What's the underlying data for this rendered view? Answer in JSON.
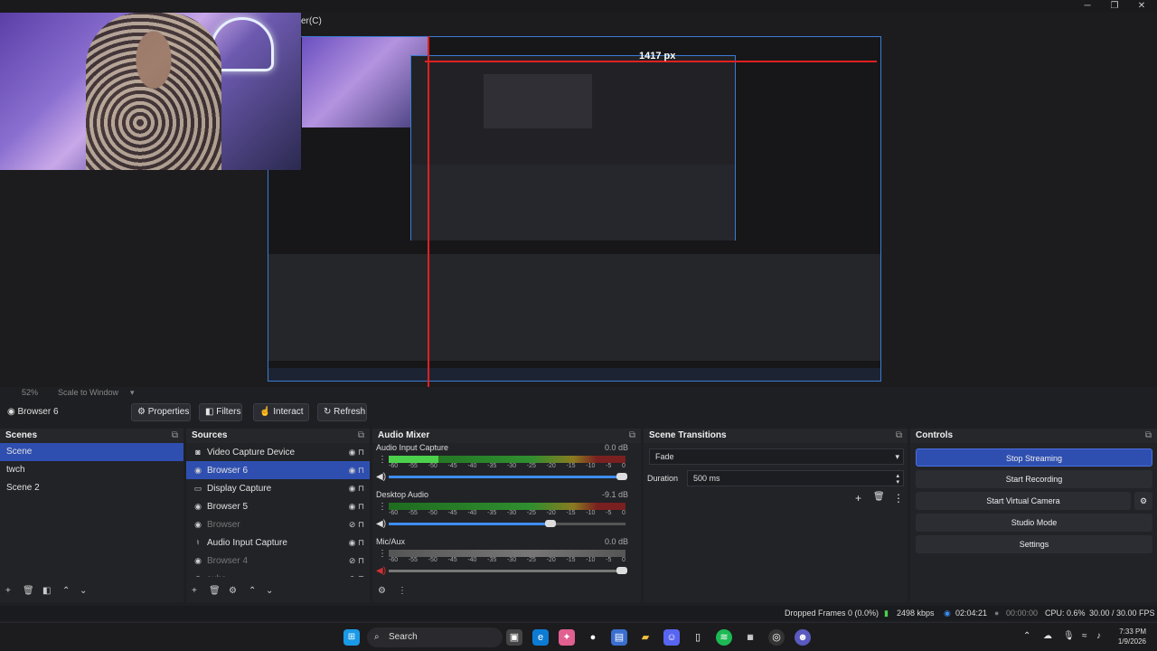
{
  "window": {
    "title_fragment": "er(C)",
    "controls": [
      "─",
      "❐",
      "✕"
    ]
  },
  "preview": {
    "measure_label": "1417 px",
    "zoom_label": "52%",
    "zoom_mode": "Scale to Window"
  },
  "toolbar": {
    "source_name": "Browser 6",
    "properties": "Properties",
    "filters": "Filters",
    "interact": "Interact",
    "refresh": "Refresh"
  },
  "scenes": {
    "title": "Scenes",
    "items": [
      {
        "label": "Scene",
        "selected": true
      },
      {
        "label": "twch"
      },
      {
        "label": "Scene 2"
      }
    ]
  },
  "sources": {
    "title": "Sources",
    "items": [
      {
        "label": "Video Capture Device",
        "icon": "camera-icon"
      },
      {
        "label": "Browser 6",
        "icon": "globe-icon"
      },
      {
        "label": "Display Capture",
        "icon": "monitor-icon"
      },
      {
        "label": "Browser 5",
        "icon": "globe-icon"
      },
      {
        "label": "Browser",
        "icon": "globe-icon"
      },
      {
        "label": "Audio Input Capture",
        "icon": "microphone-icon"
      },
      {
        "label": "Browser 4",
        "icon": "globe-icon"
      },
      {
        "label": "subs",
        "icon": "globe-icon"
      }
    ]
  },
  "mixer": {
    "title": "Audio Mixer",
    "ticks": [
      "-60",
      "-55",
      "-50",
      "-45",
      "-40",
      "-35",
      "-30",
      "-25",
      "-20",
      "-15",
      "-10",
      "-5",
      "0"
    ],
    "channels": [
      {
        "name": "Audio Input Capture",
        "db": "0.0 dB",
        "level": 0.21,
        "volume": 1.0
      },
      {
        "name": "Desktop Audio",
        "db": "-9.1 dB",
        "level": 0,
        "volume": 0.7
      },
      {
        "name": "Mic/Aux",
        "db": "0.0 dB",
        "level": 0,
        "volume": 1.0
      }
    ]
  },
  "transitions": {
    "title": "Scene Transitions",
    "selected": "Fade",
    "duration_label": "Duration",
    "duration_value": "500 ms"
  },
  "controls": {
    "title": "Controls",
    "stop_streaming": "Stop Streaming",
    "start_recording": "Start Recording",
    "start_virtual_camera": "Start Virtual Camera",
    "studio_mode": "Studio Mode",
    "settings": "Settings"
  },
  "status": {
    "dropped": "Dropped Frames 0 (0.0%)",
    "bitrate": "2498 kbps",
    "stream_time": "02:04:21",
    "rec_time": "00:00:00",
    "cpu": "CPU: 0.6%",
    "fps": "30.00 / 30.00 FPS"
  },
  "taskbar": {
    "search": "Search",
    "time": "7:33 PM",
    "date": "1/9/2026"
  },
  "colors": {
    "accent": "#2f4fb0",
    "meter_green": "#4cd04c",
    "guide_red": "#e02020"
  }
}
